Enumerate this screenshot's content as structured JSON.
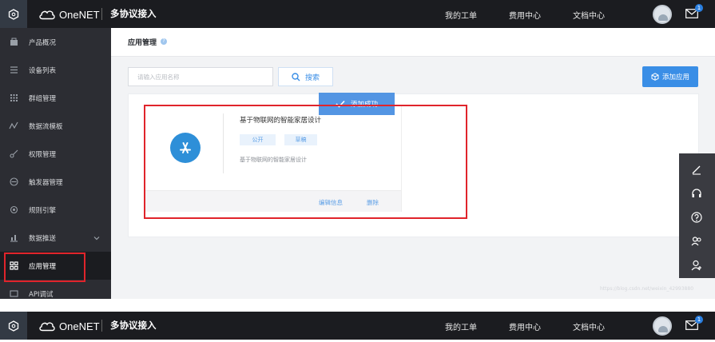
{
  "header": {
    "brand": "OneNET",
    "project": "多协议接入",
    "nav": [
      "我的工单",
      "费用中心",
      "文档中心"
    ],
    "mail_count": "1"
  },
  "sidebar": {
    "items": [
      {
        "label": "产品概况",
        "icon": "product-icon"
      },
      {
        "label": "设备列表",
        "icon": "list-icon"
      },
      {
        "label": "群组管理",
        "icon": "grid-dots-icon"
      },
      {
        "label": "数据流模板",
        "icon": "stream-icon"
      },
      {
        "label": "权限管理",
        "icon": "key-icon"
      },
      {
        "label": "触发器管理",
        "icon": "trigger-icon"
      },
      {
        "label": "规则引擎",
        "icon": "rule-icon"
      },
      {
        "label": "数据推送",
        "icon": "push-icon"
      },
      {
        "label": "应用管理",
        "icon": "apps-icon"
      },
      {
        "label": "API调试",
        "icon": "api-icon"
      }
    ]
  },
  "page": {
    "title": "应用管理",
    "search_placeholder": "请输入应用名称",
    "search_label": "搜索",
    "add_label": "添加应用"
  },
  "toast": {
    "text": "添加成功"
  },
  "app_card": {
    "title": "基于物联网的智能家居设计",
    "tags": [
      "公开",
      "草稿"
    ],
    "desc": "基于物联网的智能家居设计",
    "edit_label": "编辑信息",
    "delete_label": "删除"
  },
  "watermark": "https://blog.csdn.net/weixin_42993880"
}
